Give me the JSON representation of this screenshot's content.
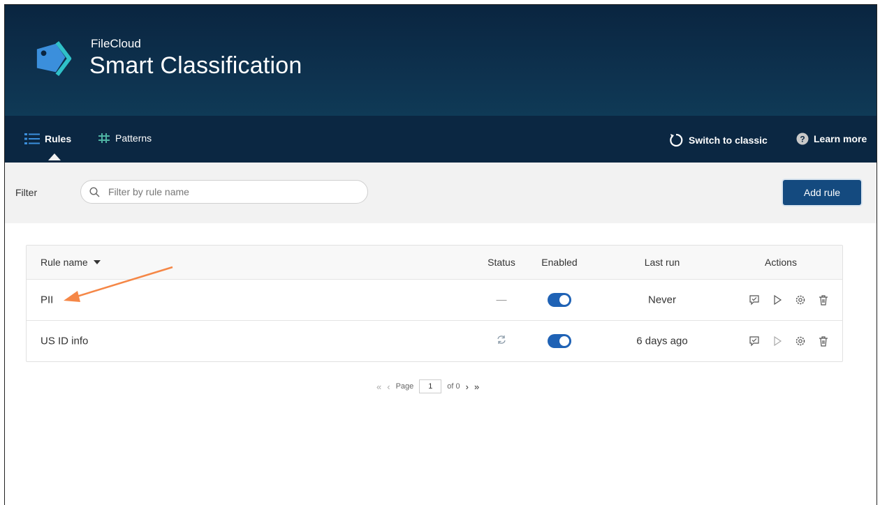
{
  "header": {
    "brand_small": "FileCloud",
    "brand_title": "Smart Classification"
  },
  "nav": {
    "tabs": [
      {
        "label": "Rules",
        "active": true
      },
      {
        "label": "Patterns",
        "active": false
      }
    ],
    "switch_label": "Switch to classic",
    "learn_label": "Learn more"
  },
  "filter": {
    "label": "Filter",
    "placeholder": "Filter by rule name",
    "add_button": "Add rule"
  },
  "table": {
    "columns": [
      "Rule name",
      "Status",
      "Enabled",
      "Last run",
      "Actions"
    ],
    "rows": [
      {
        "name": "PII",
        "status": "—",
        "enabled": true,
        "last_run": "Never"
      },
      {
        "name": "US ID info",
        "status": "syncing",
        "enabled": true,
        "last_run": "6 days ago"
      }
    ]
  },
  "pager": {
    "page_label": "Page",
    "page_value": "1",
    "of_label": "of 0"
  },
  "colors": {
    "header_dark": "#0a2540",
    "nav": "#0b2742",
    "accent": "#1f62b5",
    "button": "#144a7f",
    "arrow": "#f58747",
    "logo": "#3b8fdc"
  }
}
